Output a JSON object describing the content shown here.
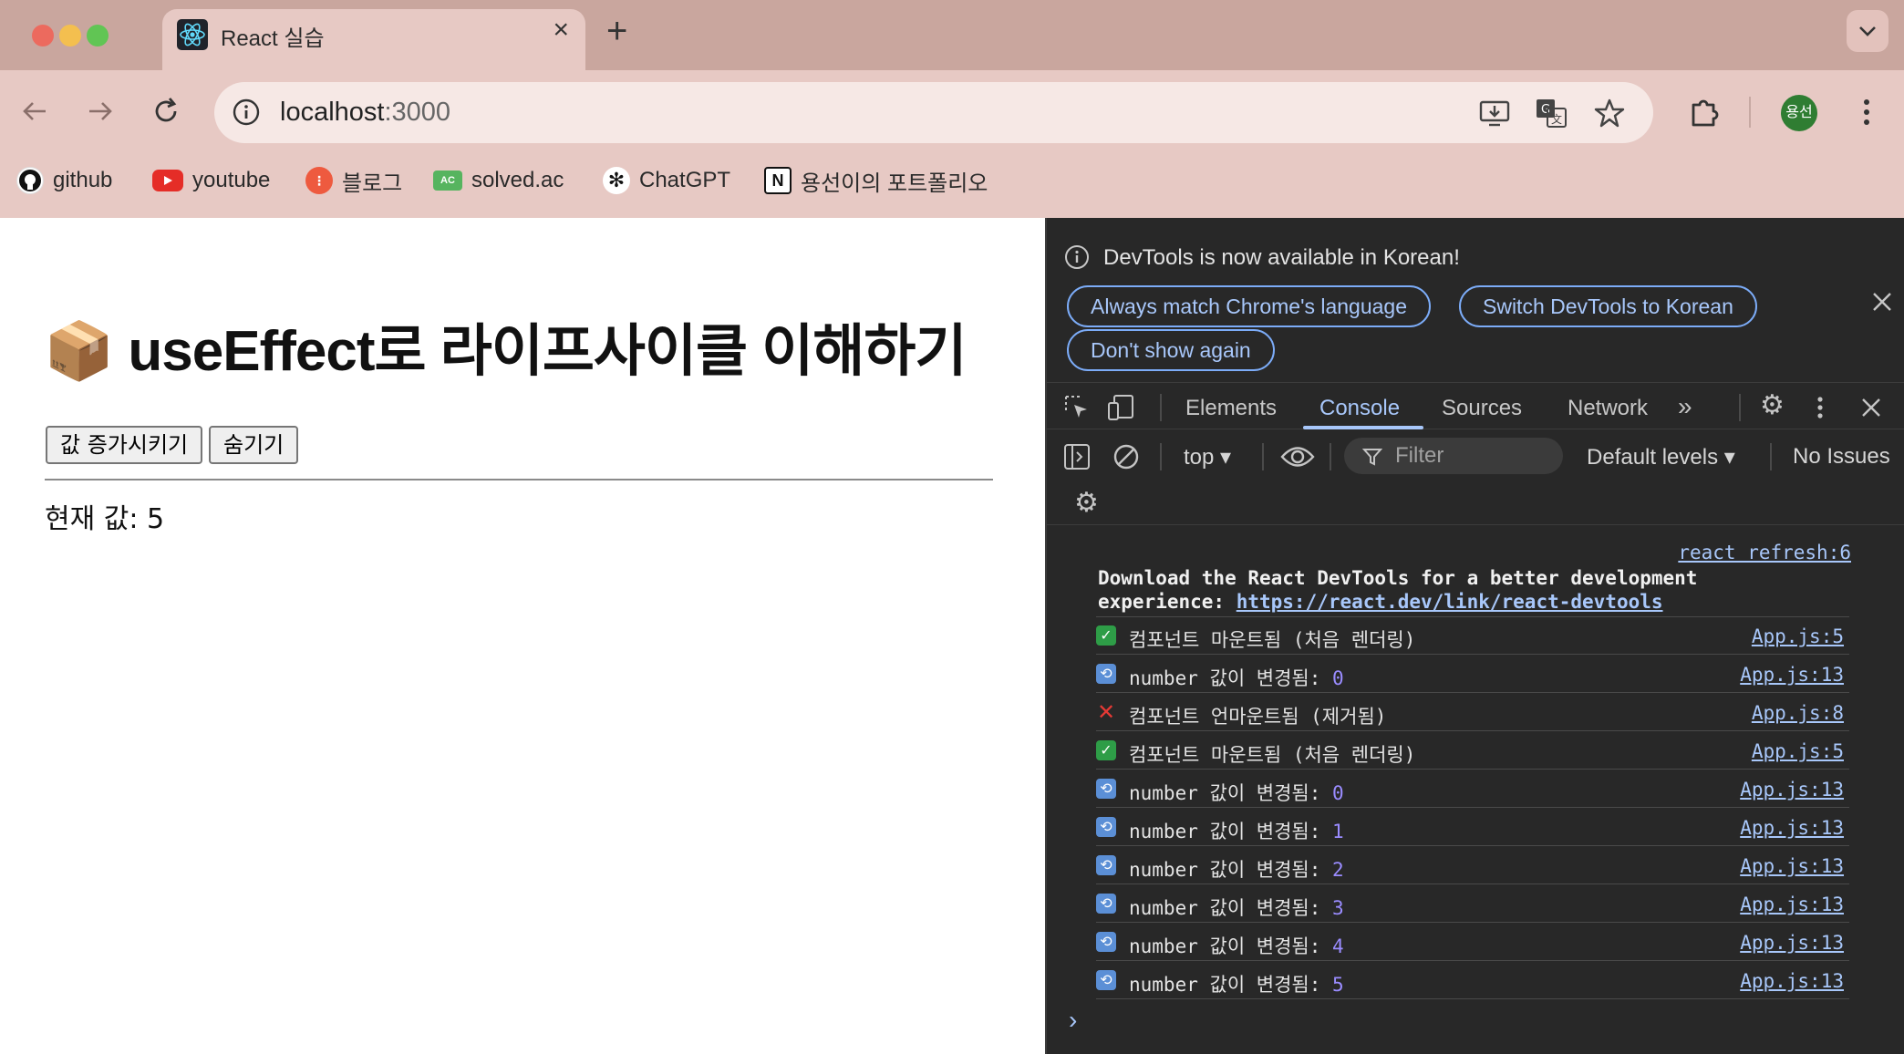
{
  "browser": {
    "tab_title": "React 실습",
    "tab_close": "×",
    "new_tab": "+",
    "url_host": "localhost",
    "url_port": ":3000",
    "avatar_text": "용선",
    "bookmarks": [
      {
        "label": "github",
        "icon": "github-icon"
      },
      {
        "label": "youtube",
        "icon": "youtube-icon"
      },
      {
        "label": "블로그",
        "icon": "blog-icon"
      },
      {
        "label": "solved.ac",
        "icon": "solvedac-icon"
      },
      {
        "label": "ChatGPT",
        "icon": "chatgpt-icon"
      },
      {
        "label": "용선이의 포트폴리오",
        "icon": "notion-icon"
      }
    ]
  },
  "page": {
    "heading": "📦 useEffect로 라이프사이클 이해하기",
    "increment_button": "값 증가시키기",
    "hide_button": "숨기기",
    "current_value": "현재 값: 5"
  },
  "devtools": {
    "banner_message": "DevTools is now available in Korean!",
    "banner_buttons": [
      "Always match Chrome's language",
      "Switch DevTools to Korean",
      "Don't show again"
    ],
    "tabs": [
      "Elements",
      "Console",
      "Sources",
      "Network"
    ],
    "active_tab": "Console",
    "context": "top",
    "filter_placeholder": "Filter",
    "levels": "Default levels",
    "issues": "No Issues",
    "messages": [
      {
        "text": "컴포넌트 마운트됨 (처음 렌더링)",
        "value": "",
        "src": "App.js:5",
        "icon": "check-icon"
      },
      {
        "text": "number 값이 변경됨: ",
        "value": "0",
        "src": "App.js:13",
        "icon": "repeat-icon"
      },
      {
        "text": "컴포넌트 언마운트됨 (제거됨)",
        "value": "",
        "src": "App.js:8",
        "icon": "cross-icon"
      },
      {
        "text": "컴포넌트 마운트됨 (처음 렌더링)",
        "value": "",
        "src": "App.js:5",
        "icon": "check-icon"
      },
      {
        "text": "number 값이 변경됨: ",
        "value": "0",
        "src": "App.js:13",
        "icon": "repeat-icon"
      },
      {
        "text": "number 값이 변경됨: ",
        "value": "1",
        "src": "App.js:13",
        "icon": "repeat-icon"
      },
      {
        "text": "number 값이 변경됨: ",
        "value": "2",
        "src": "App.js:13",
        "icon": "repeat-icon"
      },
      {
        "text": "number 값이 변경됨: ",
        "value": "3",
        "src": "App.js:13",
        "icon": "repeat-icon"
      },
      {
        "text": "number 값이 변경됨: ",
        "value": "4",
        "src": "App.js:13",
        "icon": "repeat-icon"
      },
      {
        "text": "number 값이 변경됨: ",
        "value": "5",
        "src": "App.js:13",
        "icon": "repeat-icon"
      }
    ],
    "refresh_src": "react refresh:6",
    "devtools_msg_1": "Download the React DevTools for a better development",
    "devtools_msg_2": "experience: ",
    "devtools_link": "https://react.dev/link/react-devtools",
    "prompt": "›"
  }
}
